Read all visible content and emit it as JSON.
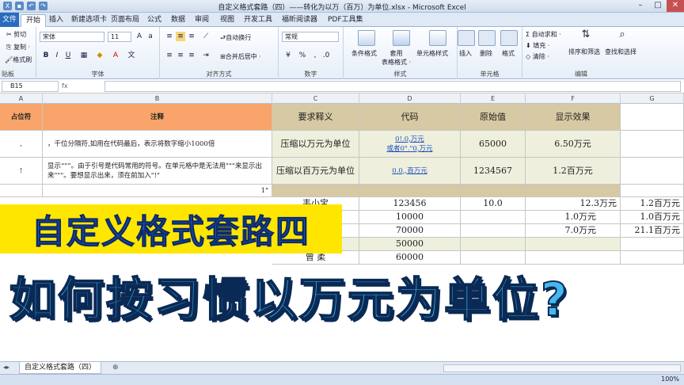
{
  "window": {
    "title": "自定义格式套路（四）——转化为以万（百万）为单位.xlsx - Microsoft Excel"
  },
  "tabs": [
    "文件",
    "开始",
    "插入",
    "新建选项卡",
    "页面布局",
    "公式",
    "数据",
    "审阅",
    "视图",
    "开发工具",
    "福昕阅读器",
    "PDF工具集"
  ],
  "ribbon": {
    "clipboard": {
      "cut": "剪切",
      "copy": "复制 ·",
      "format_painter": "格式刷",
      "label": "贴板"
    },
    "font": {
      "name": "宋体",
      "size": "11",
      "bold": "B",
      "italic": "I",
      "underline": "U",
      "label": "字体"
    },
    "alignment": {
      "wrap": "自动换行",
      "merge": "合并后居中 ·",
      "label": "对齐方式"
    },
    "number": {
      "format": "常规",
      "label": "数字"
    },
    "styles": {
      "conditional": "条件格式",
      "table": "套用\n表格格式 ·",
      "cell_styles": "单元格样式",
      "label": "样式"
    },
    "cells": {
      "insert": "插入",
      "delete": "删除",
      "format": "格式",
      "label": "单元格"
    },
    "editing": {
      "autosum": "自动求和 ·",
      "fill": "填充 ·",
      "clear": "清除 ·",
      "sort": "排序和筛选",
      "find": "查找和选择",
      "label": "编辑"
    }
  },
  "formula_bar": {
    "name_box": "B15",
    "fx": "fx",
    "value": ""
  },
  "columns": [
    "A",
    "B",
    "C",
    "D",
    "E",
    "F",
    "G"
  ],
  "table": {
    "header": {
      "a": "占位符",
      "b": "注释",
      "c": "要求释义",
      "d": "代码",
      "e": "原始值",
      "f": "显示效果"
    },
    "row1": {
      "a": ",",
      "b": "，千位分隔符,如用在代码最后，表示将数字缩小1000倍",
      "c": "压缩以万元为单位",
      "d1": "0!.0,万元",
      "d2": "或者0\".\"0,万元",
      "e": "65000",
      "f": "6.50万元"
    },
    "row2": {
      "a": "!",
      "b": "显示“\"”。由于引号是代码常用的符号。在单元格中是无法用\"\"\"来显示出来\"\"\"。要想显示出来，须在前加入\"!\"",
      "c": "压缩以百万元为单位",
      "d": "0.0,,百万元",
      "e": "1234567",
      "f": "1.2百万元"
    },
    "row3": {
      "b": "1\""
    },
    "rows": [
      {
        "c": "韦小宝",
        "d": "123456",
        "e": "10.0",
        "f": "12.3万元",
        "g": "1.2百万元"
      },
      {
        "c": "",
        "d": "10000",
        "e": "",
        "f": "1.0万元",
        "g": "1.0百万元"
      },
      {
        "c": "",
        "d": "70000",
        "e": "",
        "f": "7.0万元",
        "g": "21.1百万元"
      },
      {
        "c": "",
        "d": "50000",
        "e": "",
        "f": "",
        "g": ""
      },
      {
        "c": "曾 柔",
        "d": "60000",
        "e": "",
        "f": "",
        "g": ""
      }
    ]
  },
  "overlay": {
    "title1": "自定义格式套路四",
    "title2": "如何按习惯以万元为单位?"
  },
  "sheet_tab": "自定义格式套路（四）",
  "status": {
    "zoom": "100%"
  },
  "colors": {
    "orange": "#f9a46a",
    "tan": "#d7c9a3",
    "cream": "#eef0dd",
    "banner_yellow": "#ffe600",
    "banner_blue": "#1d56b8",
    "title_cyan": "#46b8ee"
  }
}
